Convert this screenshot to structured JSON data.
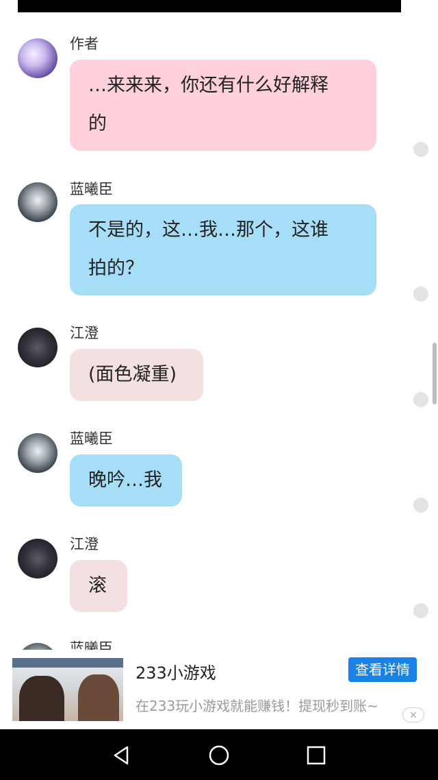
{
  "messages": [
    {
      "sender": "作者",
      "text_lines": [
        "…来来来，你还有什么好解释",
        "的"
      ],
      "avatar": "author-avatar"
    },
    {
      "sender": "蓝曦臣",
      "text_lines": [
        "不是的，这…我…那个，这谁",
        "拍的？"
      ],
      "avatar": "lan-xichen-avatar"
    },
    {
      "sender": "江澄",
      "text": "(面色凝重)",
      "avatar": "jiang-cheng-avatar"
    },
    {
      "sender": "蓝曦臣",
      "text": "晚吟…我",
      "avatar": "lan-xichen-avatar"
    },
    {
      "sender": "江澄",
      "text": "滚",
      "avatar": "jiang-cheng-avatar"
    },
    {
      "sender": "蓝曦臣",
      "text": "",
      "avatar": "lan-xichen-avatar"
    }
  ],
  "ad": {
    "title": "233小游戏",
    "description": "在233玩小游戏就能赚钱！提现秒到账~",
    "cta": "查看详情",
    "close_icon": "close-icon"
  },
  "navbar": {
    "back_icon": "back-triangle-icon",
    "home_icon": "home-circle-icon",
    "recent_icon": "recent-square-icon"
  },
  "colors": {
    "pink_bubble": "#fdd0db",
    "blue_bubble": "#a6def8",
    "rose_bubble": "#f3e1e1",
    "cta": "#1a82e6"
  }
}
